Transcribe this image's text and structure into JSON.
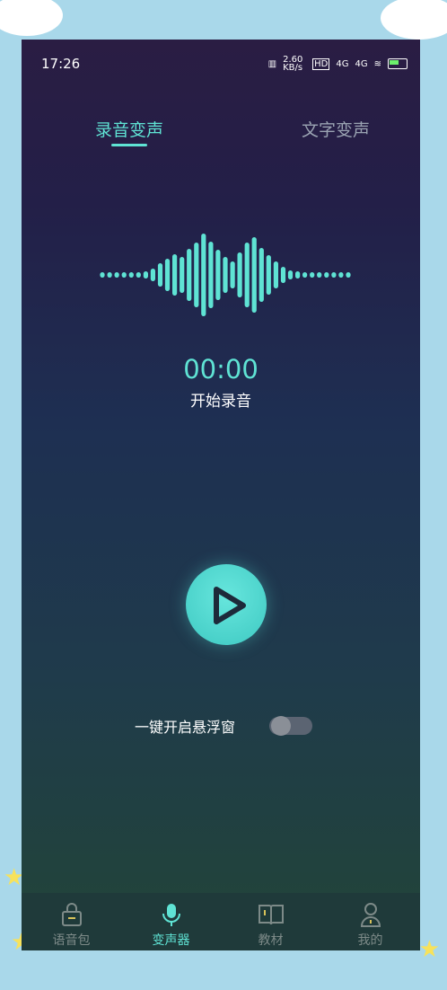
{
  "status_bar": {
    "time": "17:26",
    "net_speed": "2.60 KB/s",
    "hd": "HD",
    "sig1": "4G",
    "sig2": "4G",
    "battery": "67"
  },
  "tabs": [
    {
      "label": "录音变声",
      "active": true
    },
    {
      "label": "文字变声",
      "active": false
    }
  ],
  "recorder": {
    "timer": "00:00",
    "caption": "开始录音"
  },
  "floating_window": {
    "label": "一键开启悬浮窗",
    "enabled": false
  },
  "nav": [
    {
      "label": "语音包",
      "icon": "bag-icon",
      "active": false
    },
    {
      "label": "变声器",
      "icon": "microphone-icon",
      "active": true
    },
    {
      "label": "教材",
      "icon": "book-icon",
      "active": false
    },
    {
      "label": "我的",
      "icon": "person-icon",
      "active": false
    }
  ],
  "colors": {
    "accent": "#5fe3d4",
    "inactive": "#7d8a88"
  }
}
